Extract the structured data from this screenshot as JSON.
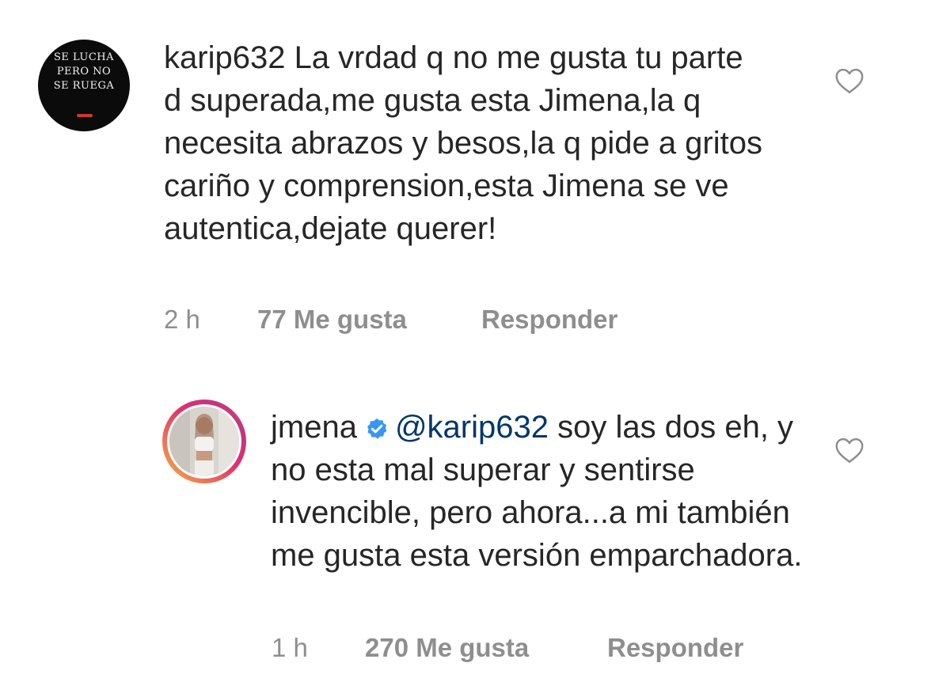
{
  "comments": [
    {
      "username": "karip632",
      "text": "La vrdad q no me gusta tu parte d superada,me gusta esta Jimena,la q necesita abrazos y besos,la q pide a gritos cariño y comprension,esta Jimena se ve autentica,dejate querer!",
      "avatar_text": [
        "SE LUCHA",
        "PERO NO",
        "SE RUEGA"
      ],
      "time": "2 h",
      "likes": "77 Me gusta",
      "reply_label": "Responder",
      "like_icon": "heart-outline-icon"
    },
    {
      "username": "jmena",
      "verified": true,
      "mention": "@karip632",
      "text": "soy las dos eh, y no esta mal superar y sentirse invencible, pero ahora...a mi también me gusta esta versión emparchadora.",
      "time": "1 h",
      "likes": "270 Me gusta",
      "reply_label": "Responder",
      "like_icon": "heart-outline-icon"
    }
  ],
  "colors": {
    "text": "#262626",
    "meta": "#8e8e8e",
    "mention": "#00376b",
    "verified": "#3897f0"
  }
}
